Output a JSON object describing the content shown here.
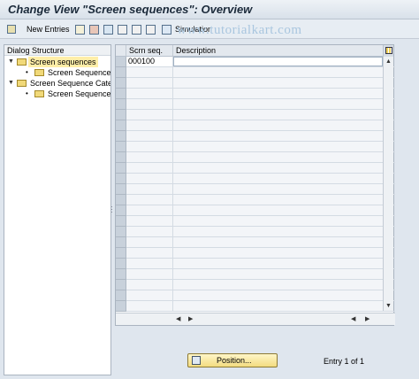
{
  "window": {
    "title": "Change View \"Screen sequences\": Overview"
  },
  "watermark": "www.tutorialkart.com",
  "toolbar": {
    "new_entries_label": "New Entries",
    "simulation_label": "Simulation",
    "icons": [
      "edit-icon",
      "copy-icon",
      "delete-icon",
      "undo-icon",
      "select-all-icon",
      "select-block-icon",
      "deselect-all-icon",
      "hierarchy-icon"
    ]
  },
  "dialog_structure": {
    "header": "Dialog Structure",
    "items": [
      {
        "label": "Screen sequences",
        "level": 0,
        "expanded": true,
        "selected": true
      },
      {
        "label": "Screen Sequence ->",
        "level": 1
      },
      {
        "label": "Screen Sequence Categ",
        "level": 0,
        "expanded": true
      },
      {
        "label": "Screen Sequence Ca",
        "level": 1
      }
    ]
  },
  "table": {
    "columns": [
      "Scrn seq.",
      "Description"
    ],
    "rows": [
      {
        "seq": "000100",
        "description": ""
      }
    ],
    "empty_rows": 23
  },
  "footer": {
    "position_button": "Position...",
    "entry_text": "Entry 1 of 1"
  },
  "colors": {
    "selected_node": "#ffeea8",
    "button_bg": "#f3dc80",
    "selector_column": "#c8d1db"
  }
}
